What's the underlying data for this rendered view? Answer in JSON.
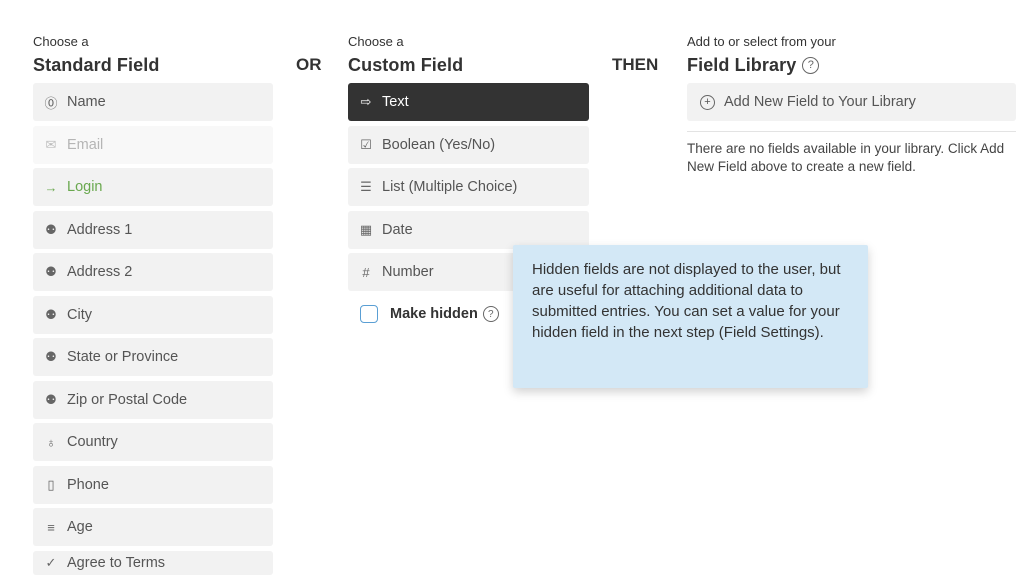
{
  "standard": {
    "eyebrow": "Choose a",
    "heading": "Standard Field",
    "items": [
      {
        "label": "Name",
        "icon": "person-circle-icon",
        "glyph": "⓪"
      },
      {
        "label": "Email",
        "icon": "envelope-icon",
        "glyph": "✉"
      },
      {
        "label": "Login",
        "icon": "login-arrow-icon",
        "glyph": "→"
      },
      {
        "label": "Address 1",
        "icon": "map-pin-icon",
        "glyph": "⚉"
      },
      {
        "label": "Address 2",
        "icon": "map-pin-icon",
        "glyph": "⚉"
      },
      {
        "label": "City",
        "icon": "map-pin-icon",
        "glyph": "⚉"
      },
      {
        "label": "State or Province",
        "icon": "map-pin-icon",
        "glyph": "⚉"
      },
      {
        "label": "Zip or Postal Code",
        "icon": "map-pin-icon",
        "glyph": "⚉"
      },
      {
        "label": "Country",
        "icon": "globe-icon",
        "glyph": "♁"
      },
      {
        "label": "Phone",
        "icon": "phone-icon",
        "glyph": "▯"
      },
      {
        "label": "Age",
        "icon": "cake-icon",
        "glyph": "≡"
      },
      {
        "label": "Agree to Terms",
        "icon": "checkmark-icon",
        "glyph": "✓"
      }
    ]
  },
  "separators": {
    "or": "OR",
    "then": "THEN"
  },
  "custom": {
    "eyebrow": "Choose a",
    "heading": "Custom Field",
    "items": [
      {
        "label": "Text",
        "icon": "text-field-icon",
        "glyph": "⇨"
      },
      {
        "label": "Boolean (Yes/No)",
        "icon": "checkbox-icon",
        "glyph": "☑"
      },
      {
        "label": "List (Multiple Choice)",
        "icon": "list-icon",
        "glyph": "☰"
      },
      {
        "label": "Date",
        "icon": "calendar-icon",
        "glyph": "▦"
      },
      {
        "label": "Number",
        "icon": "hash-icon",
        "glyph": "#"
      }
    ],
    "make_hidden_label": "Make hidden",
    "help_glyph": "?"
  },
  "library": {
    "eyebrow": "Add to or select from your",
    "heading": "Field Library",
    "add_button": "Add New Field to Your Library",
    "add_glyph": "+",
    "empty_message": "There are no fields available in your library. Click Add New Field above to create a new field."
  },
  "tooltip": {
    "text": "Hidden fields are not displayed to the user, but are useful for attaching additional data to submitted entries. You can set a value for your hidden field in the next step (Field Settings)."
  },
  "colors": {
    "active_bg": "#333333",
    "login_green": "#6aa84f",
    "tooltip_bg": "#d3e8f6",
    "checkbox_border": "#5a9fd4"
  }
}
